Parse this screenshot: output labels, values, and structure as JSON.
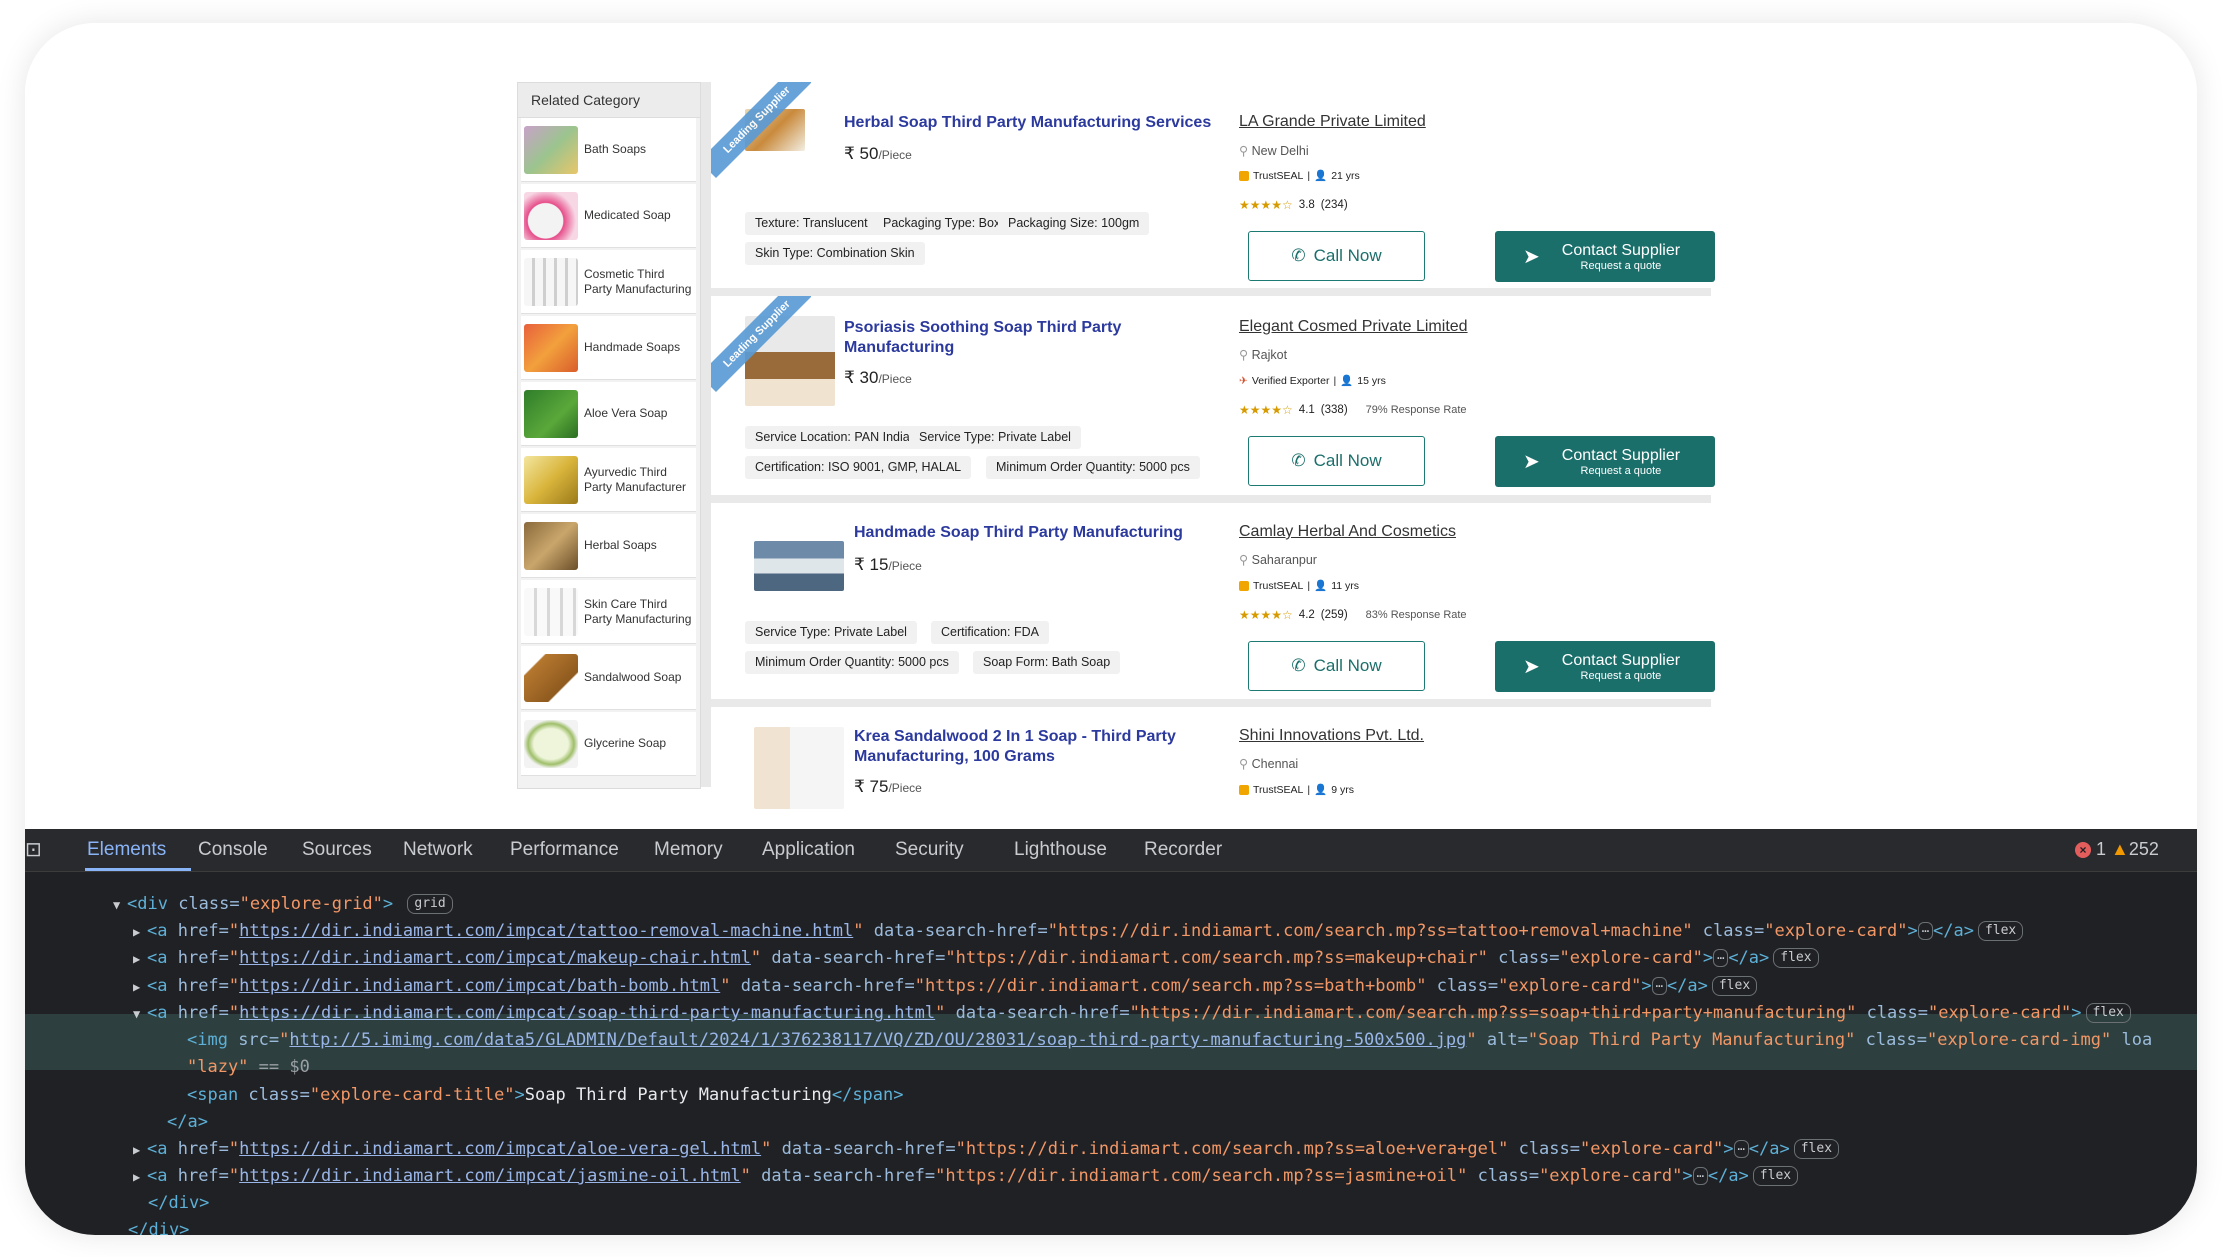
{
  "sidebar": {
    "heading": "Related Category",
    "items": [
      {
        "label": "Bath Soaps"
      },
      {
        "label": "Medicated Soap"
      },
      {
        "label": "Cosmetic Third Party Manufacturing"
      },
      {
        "label": "Handmade Soaps"
      },
      {
        "label": "Aloe Vera Soap"
      },
      {
        "label": "Ayurvedic Third Party Manufacturer"
      },
      {
        "label": "Herbal Soaps"
      },
      {
        "label": "Skin Care Third Party Manufacturing"
      },
      {
        "label": "Sandalwood Soap"
      },
      {
        "label": "Glycerine Soap"
      }
    ]
  },
  "ribbon_text": "Leading Supplier",
  "call_label": "Call Now",
  "contact_label": "Contact Supplier",
  "contact_sub": "Request a quote",
  "listings": [
    {
      "title": "Herbal Soap Third Party Manufacturing Services",
      "price": "₹ 50",
      "unit": "/Piece",
      "tags": [
        "Texture: Translucent",
        "Packaging Type: Box",
        "Packaging Size: 100gm",
        "Skin Type: Combination Skin"
      ],
      "company": "LA Grande Private Limited",
      "city": "New Delhi",
      "badge": "TrustSEAL",
      "years": "21 yrs",
      "rating": "3.8",
      "rating_count": "(234)",
      "response": ""
    },
    {
      "title_l1": "Psoriasis Soothing Soap Third Party",
      "title_l2": "Manufacturing",
      "price": "₹ 30",
      "unit": "/Piece",
      "tags": [
        "Service Location: PAN India",
        "Service Type: Private Label",
        "Certification: ISO 9001, GMP, HALAL",
        "Minimum Order Quantity: 5000 pcs"
      ],
      "company": "Elegant Cosmed Private Limited",
      "city": "Rajkot",
      "badge": "Verified Exporter",
      "years": "15 yrs",
      "rating": "4.1",
      "rating_count": "(338)",
      "response": "79% Response Rate"
    },
    {
      "title": "Handmade Soap Third Party Manufacturing",
      "price": "₹ 15",
      "unit": "/Piece",
      "tags": [
        "Service Type: Private Label",
        "Certification: FDA",
        "Minimum Order Quantity: 5000 pcs",
        "Soap Form: Bath Soap"
      ],
      "company": "Camlay Herbal And Cosmetics",
      "city": "Saharanpur",
      "badge": "TrustSEAL",
      "years": "11 yrs",
      "rating": "4.2",
      "rating_count": "(259)",
      "response": "83% Response Rate"
    },
    {
      "title_l1": "Krea Sandalwood 2 In 1 Soap - Third Party",
      "title_l2": "Manufacturing, 100 Grams",
      "price": "₹ 75",
      "unit": "/Piece",
      "company": "Shini Innovations Pvt. Ltd.",
      "city": "Chennai",
      "badge": "TrustSEAL",
      "years": "9 yrs"
    }
  ],
  "devtools": {
    "tabs": [
      "Elements",
      "Console",
      "Sources",
      "Network",
      "Performance",
      "Memory",
      "Application",
      "Security",
      "Lighthouse",
      "Recorder"
    ],
    "errors": "1",
    "warnings": "252",
    "badge_grid": "grid",
    "badge_flex": "flex",
    "lines": {
      "l0_tag": "<div",
      "l0_attr": " class=",
      "l0_val": "\"explore-grid\"",
      "l0_close": ">",
      "a_open": "<a",
      "href_attr": " href=",
      "dsh_attr": " data-search-href=",
      "class_attr": " class=",
      "card_val": "\"explore-card\"",
      "end_a": "</a>",
      "gt": ">",
      "q": "\"",
      "r1_href": "https://dir.indiamart.com/impcat/tattoo-removal-machine.html",
      "r1_dsh": "https://dir.indiamart.com/search.mp?ss=tattoo+removal+machine",
      "r2_href": "https://dir.indiamart.com/impcat/makeup-chair.html",
      "r2_dsh": "https://dir.indiamart.com/search.mp?ss=makeup+chair",
      "r3_href": "https://dir.indiamart.com/impcat/bath-bomb.html",
      "r3_dsh": "https://dir.indiamart.com/search.mp?ss=bath+bomb",
      "r4_href": "https://dir.indiamart.com/impcat/soap-third-party-manufacturing.html",
      "r4_dsh": "https://dir.indiamart.com/search.mp?ss=soap+third+party+manufacturing",
      "img_tag": "<img",
      "src_attr": " src=",
      "img_src": "http://5.imimg.com/data5/GLADMIN/Default/2024/1/376238117/VQ/ZD/OU/28031/soap-third-party-manufacturing-500x500.jpg",
      "alt_attr": " alt=",
      "alt_val": "\"Soap Third Party Manufacturing\"",
      "img_class": "\"explore-card-img\"",
      "loa": " loa",
      "lazy": "\"lazy\"",
      "eq": " == $0",
      "span_tag": "<span",
      "span_class": "\"explore-card-title\"",
      "span_text": "Soap Third Party Manufacturing",
      "span_end": "</span>",
      "r5_href": "https://dir.indiamart.com/impcat/aloe-vera-gel.html",
      "r5_dsh": "https://dir.indiamart.com/search.mp?ss=aloe+vera+gel",
      "r6_href": "https://dir.indiamart.com/impcat/jasmine-oil.html",
      "r6_dsh": "https://dir.indiamart.com/search.mp?ss=jasmine+oil",
      "end_div": "</div>"
    }
  },
  "colors": {
    "accent_teal": "#1b6f6b",
    "title_blue": "#2c3a9e",
    "devtools_bg": "#202124"
  }
}
